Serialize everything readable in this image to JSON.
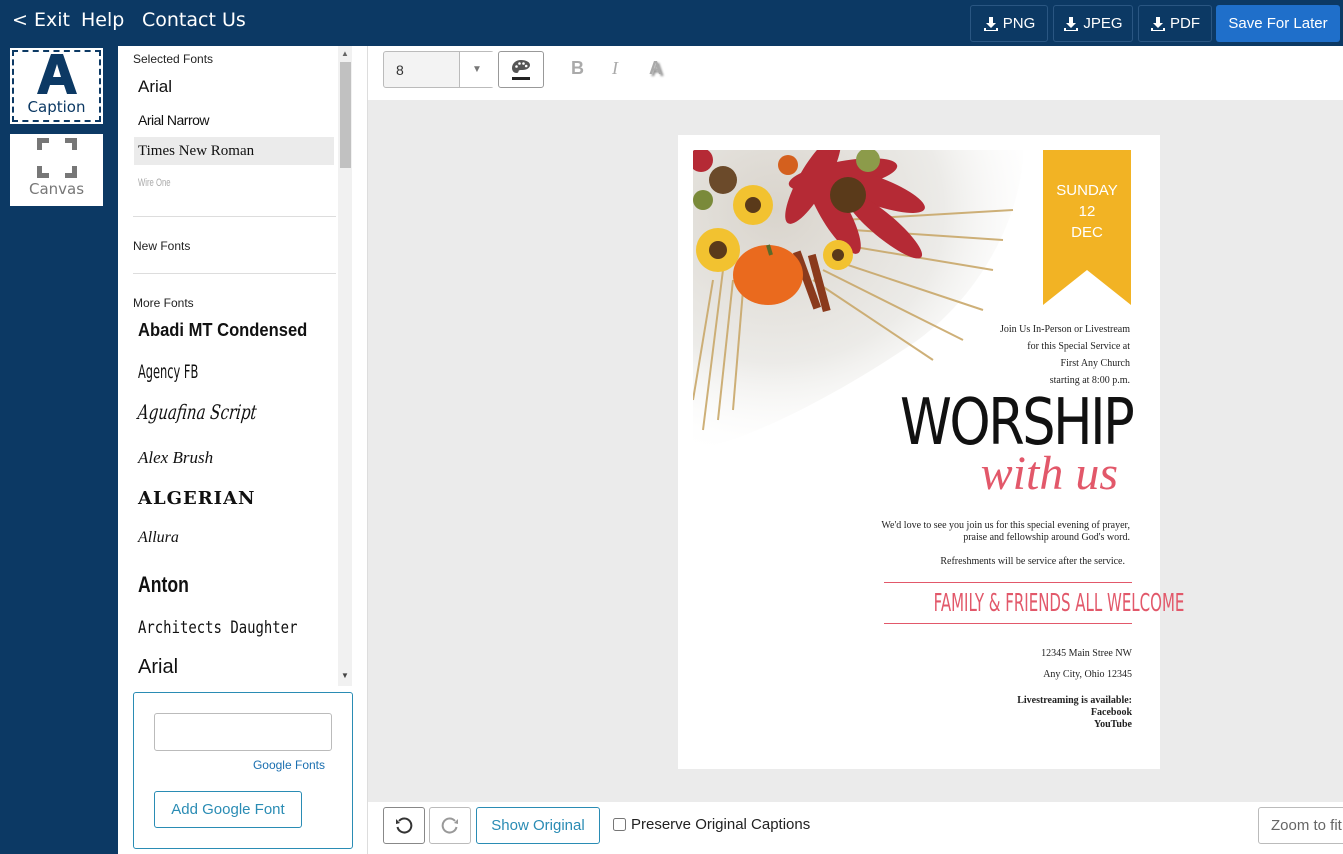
{
  "topbar": {
    "exit": "< Exit",
    "help": "Help",
    "contact": "Contact Us",
    "png": "PNG",
    "jpeg": "JPEG",
    "pdf": "PDF",
    "save": "Save For Later"
  },
  "rail": {
    "caption": "Caption",
    "canvas": "Canvas"
  },
  "fonts": {
    "selected_title": "Selected Fonts",
    "selected": [
      "Arial",
      "Arial Narrow",
      "Times New Roman",
      "Wire One"
    ],
    "new_title": "New Fonts",
    "more_title": "More Fonts",
    "more": [
      "Abadi MT Condensed",
      "Agency FB",
      "Aguafina Script",
      "Alex Brush",
      "ALGERIAN",
      "Allura",
      "Anton",
      "Architects Daughter",
      "Arial"
    ],
    "google_link": "Google Fonts",
    "add_google": "Add Google Font"
  },
  "toolbar": {
    "size": "8",
    "bold": "B",
    "italic": "I",
    "shadow": "A"
  },
  "bottom": {
    "show_original": "Show Original",
    "preserve": "Preserve Original Captions",
    "zoom": "Zoom to fit"
  },
  "flyer": {
    "day": "SUNDAY",
    "date": "12",
    "month": "DEC",
    "intro1": "Join Us In-Person or Livestream",
    "intro2": "for this Special Service at",
    "intro3": "First Any Church",
    "intro4": "starting at 8:00 p.m.",
    "worship": "WORSHIP",
    "withus": "with us",
    "body1": "We'd love to see you join us for this special evening of prayer,",
    "body2": "praise and fellowship around God's word.",
    "refresh": "Refreshments will be service after the service.",
    "welcome": "FAMILY & FRIENDS ALL WELCOME",
    "addr1": "12345 Main Stree NW",
    "addr2": "Any City, Ohio 12345",
    "live": "Livestreaming is available:",
    "fb": "Facebook",
    "yt": "YouTube"
  },
  "colors": {
    "navy": "#0c3964",
    "accent": "#1f6fca",
    "ribbon": "#f2b324",
    "pink": "#e2586a"
  }
}
